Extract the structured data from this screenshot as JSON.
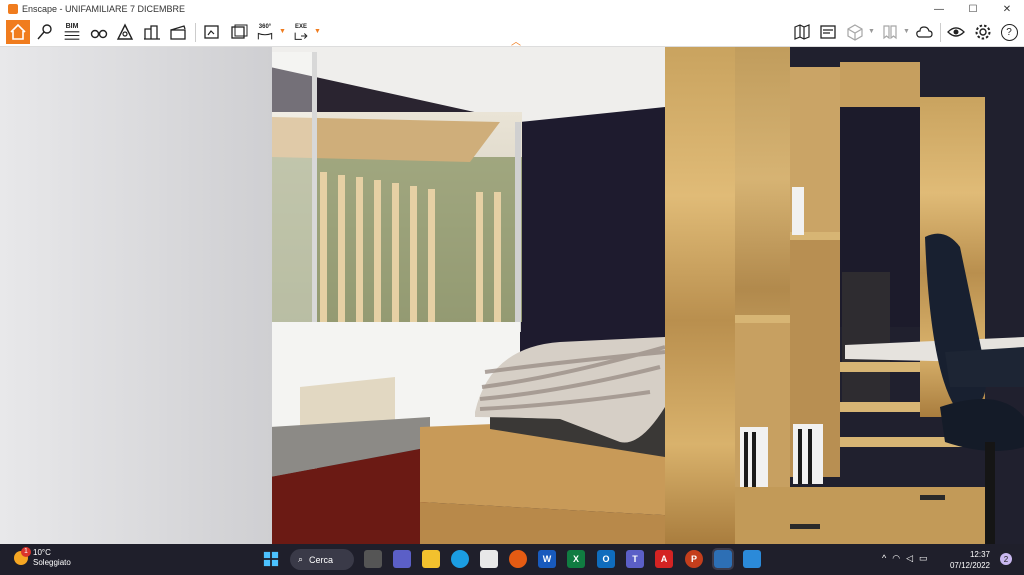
{
  "window": {
    "title": "Enscape - UNIFAMILIARE 7 DICEMBRE",
    "minimize": "—",
    "maximize": "☐",
    "close": "✕"
  },
  "toolbar": {
    "bim_label": "BIM",
    "export_360_label": "360°",
    "export_exe_label": "EXE",
    "help_label": "?"
  },
  "taskbar": {
    "weather_temp": "10°C",
    "weather_desc": "Soleggiato",
    "weather_badge": "1",
    "search_label": "Cerca",
    "time": "12:37",
    "date": "07/12/2022",
    "notification_count": "2"
  },
  "colors": {
    "accent": "#f07c1e",
    "taskbar": "#1f1f2b"
  }
}
